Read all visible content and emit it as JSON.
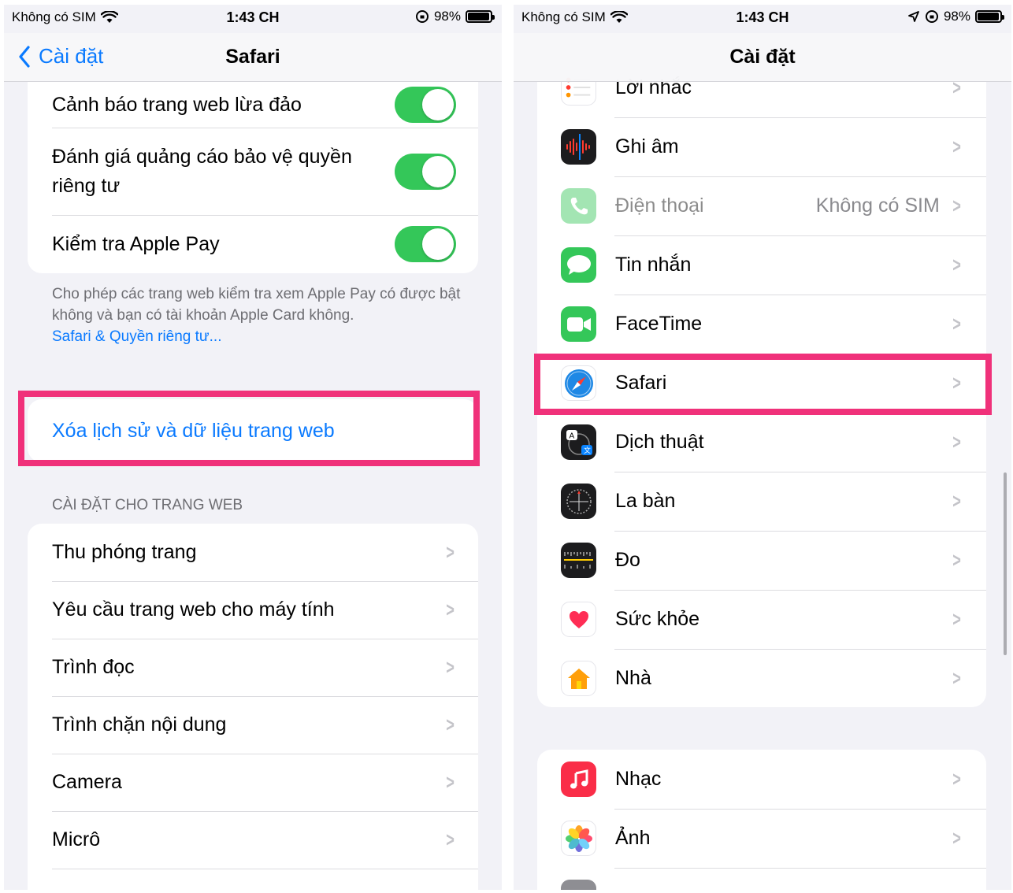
{
  "left": {
    "status": {
      "carrier": "Không có SIM",
      "time": "1:43 CH",
      "battery": "98%"
    },
    "nav": {
      "back_label": "Cài đặt",
      "title": "Safari"
    },
    "toggles": [
      {
        "label": "Cảnh báo trang web lừa đảo",
        "on": true
      },
      {
        "label": "Đánh giá quảng cáo bảo vệ quyền riêng tư",
        "on": true
      },
      {
        "label": "Kiểm tra Apple Pay",
        "on": true
      }
    ],
    "footnote": {
      "text": "Cho phép các trang web kiểm tra xem Apple Pay có được bật không và bạn có tài khoản Apple Card không.",
      "link": "Safari & Quyền riêng tư..."
    },
    "clear_history": "Xóa lịch sử và dữ liệu trang web",
    "section_header": "CÀI ĐẶT CHO TRANG WEB",
    "website_settings": [
      "Thu phóng trang",
      "Yêu cầu trang web cho máy tính",
      "Trình đọc",
      "Trình chặn nội dung",
      "Camera",
      "Micrô"
    ]
  },
  "right": {
    "status": {
      "carrier": "Không có SIM",
      "time": "1:43 CH",
      "battery": "98%"
    },
    "nav": {
      "title": "Cài đặt"
    },
    "apps_group1": [
      {
        "label": "Lời nhắc",
        "icon": "reminders-icon",
        "color": "#ffffff"
      },
      {
        "label": "Ghi âm",
        "icon": "voice-memos-icon",
        "color": "#1c1c1e"
      },
      {
        "label": "Điện thoại",
        "icon": "phone-icon",
        "color": "#34c759",
        "value": "Không có SIM"
      },
      {
        "label": "Tin nhắn",
        "icon": "messages-icon",
        "color": "#34c759"
      },
      {
        "label": "FaceTime",
        "icon": "facetime-icon",
        "color": "#34c759"
      },
      {
        "label": "Safari",
        "icon": "safari-icon",
        "color": "#1e88e5"
      },
      {
        "label": "Dịch thuật",
        "icon": "translate-icon",
        "color": "#1c1c1e"
      },
      {
        "label": "La bàn",
        "icon": "compass-icon",
        "color": "#1c1c1e"
      },
      {
        "label": "Đo",
        "icon": "measure-icon",
        "color": "#1c1c1e"
      },
      {
        "label": "Sức khỏe",
        "icon": "health-icon",
        "color": "#ffffff"
      },
      {
        "label": "Nhà",
        "icon": "home-icon",
        "color": "#ffffff"
      }
    ],
    "apps_group2": [
      {
        "label": "Nhạc",
        "icon": "music-icon",
        "color": "#fa2d48"
      },
      {
        "label": "Ảnh",
        "icon": "photos-icon",
        "color": "#ffffff"
      }
    ]
  },
  "colors": {
    "accent": "#0a7aff",
    "toggle_on": "#34c759",
    "highlight": "#f0317a",
    "background": "#f2f2f7"
  }
}
